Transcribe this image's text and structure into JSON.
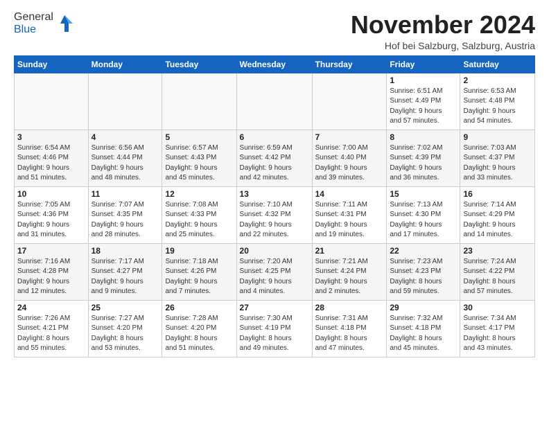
{
  "logo": {
    "general": "General",
    "blue": "Blue"
  },
  "header": {
    "month": "November 2024",
    "location": "Hof bei Salzburg, Salzburg, Austria"
  },
  "weekdays": [
    "Sunday",
    "Monday",
    "Tuesday",
    "Wednesday",
    "Thursday",
    "Friday",
    "Saturday"
  ],
  "weeks": [
    [
      {
        "day": "",
        "detail": ""
      },
      {
        "day": "",
        "detail": ""
      },
      {
        "day": "",
        "detail": ""
      },
      {
        "day": "",
        "detail": ""
      },
      {
        "day": "",
        "detail": ""
      },
      {
        "day": "1",
        "detail": "Sunrise: 6:51 AM\nSunset: 4:49 PM\nDaylight: 9 hours\nand 57 minutes."
      },
      {
        "day": "2",
        "detail": "Sunrise: 6:53 AM\nSunset: 4:48 PM\nDaylight: 9 hours\nand 54 minutes."
      }
    ],
    [
      {
        "day": "3",
        "detail": "Sunrise: 6:54 AM\nSunset: 4:46 PM\nDaylight: 9 hours\nand 51 minutes."
      },
      {
        "day": "4",
        "detail": "Sunrise: 6:56 AM\nSunset: 4:44 PM\nDaylight: 9 hours\nand 48 minutes."
      },
      {
        "day": "5",
        "detail": "Sunrise: 6:57 AM\nSunset: 4:43 PM\nDaylight: 9 hours\nand 45 minutes."
      },
      {
        "day": "6",
        "detail": "Sunrise: 6:59 AM\nSunset: 4:42 PM\nDaylight: 9 hours\nand 42 minutes."
      },
      {
        "day": "7",
        "detail": "Sunrise: 7:00 AM\nSunset: 4:40 PM\nDaylight: 9 hours\nand 39 minutes."
      },
      {
        "day": "8",
        "detail": "Sunrise: 7:02 AM\nSunset: 4:39 PM\nDaylight: 9 hours\nand 36 minutes."
      },
      {
        "day": "9",
        "detail": "Sunrise: 7:03 AM\nSunset: 4:37 PM\nDaylight: 9 hours\nand 33 minutes."
      }
    ],
    [
      {
        "day": "10",
        "detail": "Sunrise: 7:05 AM\nSunset: 4:36 PM\nDaylight: 9 hours\nand 31 minutes."
      },
      {
        "day": "11",
        "detail": "Sunrise: 7:07 AM\nSunset: 4:35 PM\nDaylight: 9 hours\nand 28 minutes."
      },
      {
        "day": "12",
        "detail": "Sunrise: 7:08 AM\nSunset: 4:33 PM\nDaylight: 9 hours\nand 25 minutes."
      },
      {
        "day": "13",
        "detail": "Sunrise: 7:10 AM\nSunset: 4:32 PM\nDaylight: 9 hours\nand 22 minutes."
      },
      {
        "day": "14",
        "detail": "Sunrise: 7:11 AM\nSunset: 4:31 PM\nDaylight: 9 hours\nand 19 minutes."
      },
      {
        "day": "15",
        "detail": "Sunrise: 7:13 AM\nSunset: 4:30 PM\nDaylight: 9 hours\nand 17 minutes."
      },
      {
        "day": "16",
        "detail": "Sunrise: 7:14 AM\nSunset: 4:29 PM\nDaylight: 9 hours\nand 14 minutes."
      }
    ],
    [
      {
        "day": "17",
        "detail": "Sunrise: 7:16 AM\nSunset: 4:28 PM\nDaylight: 9 hours\nand 12 minutes."
      },
      {
        "day": "18",
        "detail": "Sunrise: 7:17 AM\nSunset: 4:27 PM\nDaylight: 9 hours\nand 9 minutes."
      },
      {
        "day": "19",
        "detail": "Sunrise: 7:18 AM\nSunset: 4:26 PM\nDaylight: 9 hours\nand 7 minutes."
      },
      {
        "day": "20",
        "detail": "Sunrise: 7:20 AM\nSunset: 4:25 PM\nDaylight: 9 hours\nand 4 minutes."
      },
      {
        "day": "21",
        "detail": "Sunrise: 7:21 AM\nSunset: 4:24 PM\nDaylight: 9 hours\nand 2 minutes."
      },
      {
        "day": "22",
        "detail": "Sunrise: 7:23 AM\nSunset: 4:23 PM\nDaylight: 8 hours\nand 59 minutes."
      },
      {
        "day": "23",
        "detail": "Sunrise: 7:24 AM\nSunset: 4:22 PM\nDaylight: 8 hours\nand 57 minutes."
      }
    ],
    [
      {
        "day": "24",
        "detail": "Sunrise: 7:26 AM\nSunset: 4:21 PM\nDaylight: 8 hours\nand 55 minutes."
      },
      {
        "day": "25",
        "detail": "Sunrise: 7:27 AM\nSunset: 4:20 PM\nDaylight: 8 hours\nand 53 minutes."
      },
      {
        "day": "26",
        "detail": "Sunrise: 7:28 AM\nSunset: 4:20 PM\nDaylight: 8 hours\nand 51 minutes."
      },
      {
        "day": "27",
        "detail": "Sunrise: 7:30 AM\nSunset: 4:19 PM\nDaylight: 8 hours\nand 49 minutes."
      },
      {
        "day": "28",
        "detail": "Sunrise: 7:31 AM\nSunset: 4:18 PM\nDaylight: 8 hours\nand 47 minutes."
      },
      {
        "day": "29",
        "detail": "Sunrise: 7:32 AM\nSunset: 4:18 PM\nDaylight: 8 hours\nand 45 minutes."
      },
      {
        "day": "30",
        "detail": "Sunrise: 7:34 AM\nSunset: 4:17 PM\nDaylight: 8 hours\nand 43 minutes."
      }
    ]
  ]
}
